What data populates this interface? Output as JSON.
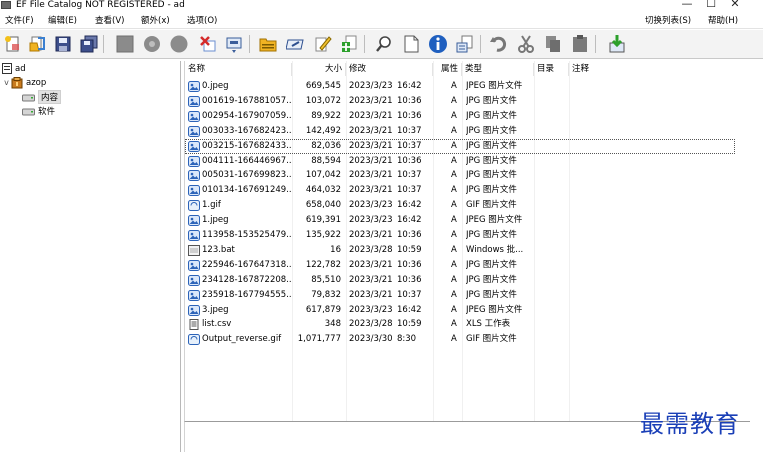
{
  "window": {
    "title": "EF File Catalog NOT REGISTERED - ad",
    "minimize": "—",
    "maximize": "☐",
    "close": "✕"
  },
  "menu": {
    "left": [
      "文件(F)",
      "编辑(E)",
      "查看(V)",
      "额外(x)",
      "选项(O)"
    ],
    "right": [
      "切换列表(S)",
      "帮助(H)"
    ]
  },
  "toolbar": {
    "icons": [
      "new-catalog-icon",
      "open-folder-icon",
      "save-icon",
      "save-all-icon",
      "gray-square-icon",
      "gray-disc-icon",
      "gray-circle-icon",
      "delete-icon",
      "rename-icon",
      "add-folder-icon",
      "edit-icon",
      "edit-pencil-icon",
      "add-document-icon",
      "search-icon",
      "blank-page-icon",
      "info-icon",
      "properties-icon",
      "undo-icon",
      "cut-icon",
      "copy-icon",
      "paste-icon",
      "export-icon"
    ]
  },
  "tree": {
    "root": "ad",
    "folder": "azop",
    "children": [
      "内容",
      "软件"
    ]
  },
  "columns": {
    "name": "名称",
    "size": "大小",
    "modified": "修改",
    "attr": "属性",
    "type": "类型",
    "dir": "目录",
    "comment": "注释"
  },
  "files": [
    {
      "name": "0.jpeg",
      "size": "669,545",
      "date": "2023/3/23",
      "time": "16:42",
      "attr": "A",
      "type": "JPEG 图片文件",
      "icon": "image-icon"
    },
    {
      "name": "001619-167881057...",
      "size": "103,072",
      "date": "2023/3/21",
      "time": "10:36",
      "attr": "A",
      "type": "JPG 图片文件",
      "icon": "image-icon"
    },
    {
      "name": "002954-167907059...",
      "size": "89,922",
      "date": "2023/3/21",
      "time": "10:36",
      "attr": "A",
      "type": "JPG 图片文件",
      "icon": "image-icon"
    },
    {
      "name": "003033-167682423...",
      "size": "142,492",
      "date": "2023/3/21",
      "time": "10:37",
      "attr": "A",
      "type": "JPG 图片文件",
      "icon": "image-icon"
    },
    {
      "name": "003215-167682433...",
      "size": "82,036",
      "date": "2023/3/21",
      "time": "10:37",
      "attr": "A",
      "type": "JPG 图片文件",
      "icon": "image-icon"
    },
    {
      "name": "004111-166446967...",
      "size": "88,594",
      "date": "2023/3/21",
      "time": "10:36",
      "attr": "A",
      "type": "JPG 图片文件",
      "icon": "image-icon"
    },
    {
      "name": "005031-167699823...",
      "size": "107,042",
      "date": "2023/3/21",
      "time": "10:37",
      "attr": "A",
      "type": "JPG 图片文件",
      "icon": "image-icon"
    },
    {
      "name": "010134-167691249...",
      "size": "464,032",
      "date": "2023/3/21",
      "time": "10:37",
      "attr": "A",
      "type": "JPG 图片文件",
      "icon": "image-icon"
    },
    {
      "name": "1.gif",
      "size": "658,040",
      "date": "2023/3/23",
      "time": "16:42",
      "attr": "A",
      "type": "GIF 图片文件",
      "icon": "gif-icon"
    },
    {
      "name": "1.jpeg",
      "size": "619,391",
      "date": "2023/3/23",
      "time": "16:42",
      "attr": "A",
      "type": "JPEG 图片文件",
      "icon": "image-icon"
    },
    {
      "name": "113958-153525479...",
      "size": "135,922",
      "date": "2023/3/21",
      "time": "10:36",
      "attr": "A",
      "type": "JPG 图片文件",
      "icon": "image-icon"
    },
    {
      "name": "123.bat",
      "size": "16",
      "date": "2023/3/28",
      "time": "10:59",
      "attr": "A",
      "type": "Windows 批...",
      "icon": "batch-file-icon"
    },
    {
      "name": "225946-167647318...",
      "size": "122,782",
      "date": "2023/3/21",
      "time": "10:36",
      "attr": "A",
      "type": "JPG 图片文件",
      "icon": "image-icon"
    },
    {
      "name": "234128-167872208...",
      "size": "85,510",
      "date": "2023/3/21",
      "time": "10:36",
      "attr": "A",
      "type": "JPG 图片文件",
      "icon": "image-icon"
    },
    {
      "name": "235918-167794555...",
      "size": "79,832",
      "date": "2023/3/21",
      "time": "10:37",
      "attr": "A",
      "type": "JPG 图片文件",
      "icon": "image-icon"
    },
    {
      "name": "3.jpeg",
      "size": "617,879",
      "date": "2023/3/23",
      "time": "16:42",
      "attr": "A",
      "type": "JPEG 图片文件",
      "icon": "image-icon"
    },
    {
      "name": "list.csv",
      "size": "348",
      "date": "2023/3/28",
      "time": "10:59",
      "attr": "A",
      "type": "XLS 工作表",
      "icon": "csv-file-icon"
    },
    {
      "name": "Output_reverse.gif",
      "size": "1,071,777",
      "date": "2023/3/30",
      "time": "8:30",
      "attr": "A",
      "type": "GIF 图片文件",
      "icon": "gif-icon"
    }
  ],
  "focused_index": 4,
  "watermark": "最需教育"
}
